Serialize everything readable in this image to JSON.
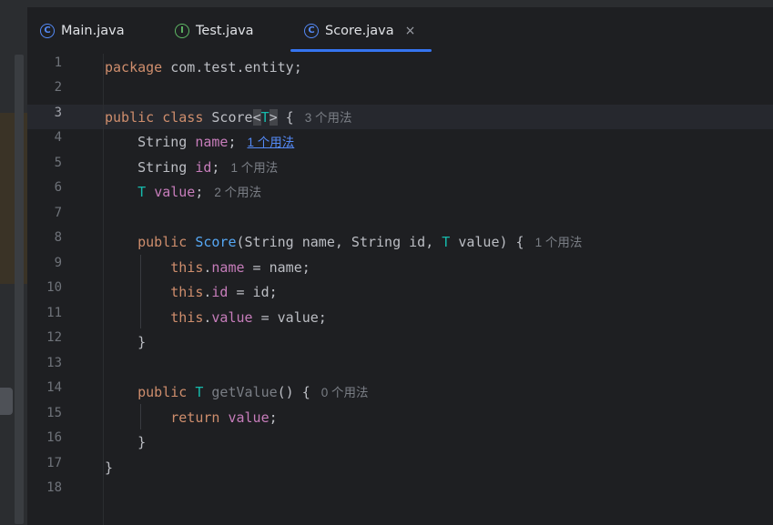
{
  "tabs": [
    {
      "label": "Main.java",
      "icon": "class-icon"
    },
    {
      "label": "Test.java",
      "icon": "interface-icon"
    },
    {
      "label": "Score.java",
      "icon": "class-icon",
      "active": true,
      "close": "×"
    }
  ],
  "line_numbers": [
    "1",
    "2",
    "3",
    "4",
    "5",
    "6",
    "7",
    "8",
    "9",
    "10",
    "11",
    "12",
    "13",
    "14",
    "15",
    "16",
    "17",
    "18"
  ],
  "code": {
    "l1": {
      "kw": "package",
      "rest": " com.test.entity;"
    },
    "l3": {
      "kw1": "public",
      "kw2": "class",
      "name": "Score",
      "lt": "<",
      "tp": "T",
      "gt": ">",
      "brace": " {",
      "hint": "3 个用法"
    },
    "l4": {
      "type": "String ",
      "field": "name",
      "semi": ";",
      "hint": "1 个用法"
    },
    "l5": {
      "type": "String ",
      "field": "id",
      "semi": ";",
      "hint": "1 个用法"
    },
    "l6": {
      "tp": "T",
      "field": "value",
      "semi": ";",
      "hint": "2 个用法"
    },
    "l8": {
      "kw": "public",
      "ctor": "Score",
      "params1": "(String name, String id, ",
      "tp": "T",
      "params2": " value) {",
      "hint": "1 个用法"
    },
    "l9": {
      "this": "this",
      "dot": ".",
      "field": "name",
      "rest": " = name;"
    },
    "l10": {
      "this": "this",
      "dot": ".",
      "field": "id",
      "rest": " = id;"
    },
    "l11": {
      "this": "this",
      "dot": ".",
      "field": "value",
      "rest": " = value;"
    },
    "l12": {
      "text": "}"
    },
    "l14": {
      "kw": "public",
      "tp": "T",
      "method": "getValue",
      "rest": "() {",
      "hint": "0 个用法"
    },
    "l15": {
      "kw": "return",
      "field": "value",
      "semi": ";"
    },
    "l16": {
      "text": "}"
    },
    "l17": {
      "text": "}"
    }
  },
  "colors": {
    "keyword": "#cf8e6d",
    "field": "#c77dbb",
    "type_param": "#16baac",
    "function": "#56a8f5",
    "hint": "#7a7e85",
    "tab_underline": "#3574f0"
  }
}
